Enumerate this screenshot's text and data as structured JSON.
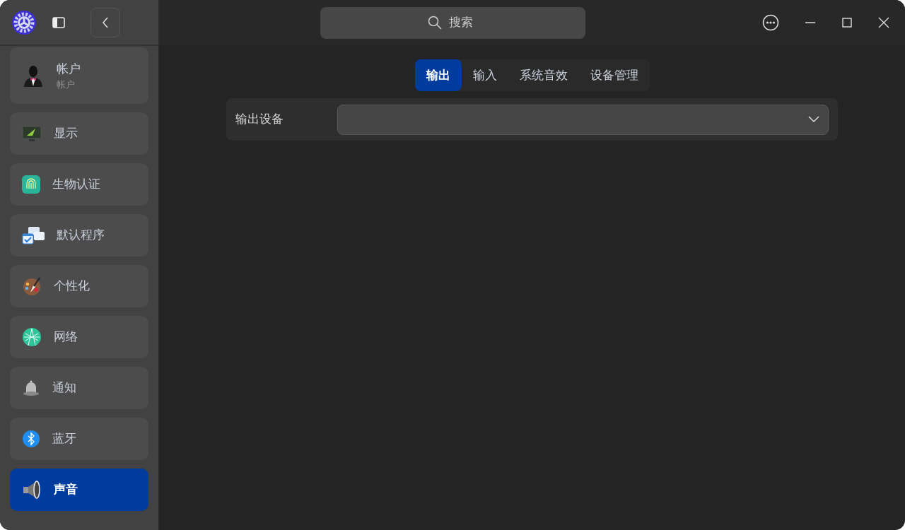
{
  "search": {
    "placeholder": "搜索"
  },
  "sidebar": {
    "items": [
      {
        "label": "帐户",
        "subtitle": "帐户",
        "selected": false
      },
      {
        "label": "显示",
        "selected": false
      },
      {
        "label": "生物认证",
        "selected": false
      },
      {
        "label": "默认程序",
        "selected": false
      },
      {
        "label": "个性化",
        "selected": false
      },
      {
        "label": "网络",
        "selected": false
      },
      {
        "label": "通知",
        "selected": false
      },
      {
        "label": "蓝牙",
        "selected": false
      },
      {
        "label": "声音",
        "selected": true
      }
    ]
  },
  "tabs": [
    {
      "label": "输出",
      "selected": true
    },
    {
      "label": "输入",
      "selected": false
    },
    {
      "label": "系统音效",
      "selected": false
    },
    {
      "label": "设备管理",
      "selected": false
    }
  ],
  "output_device": {
    "label": "输出设备"
  }
}
